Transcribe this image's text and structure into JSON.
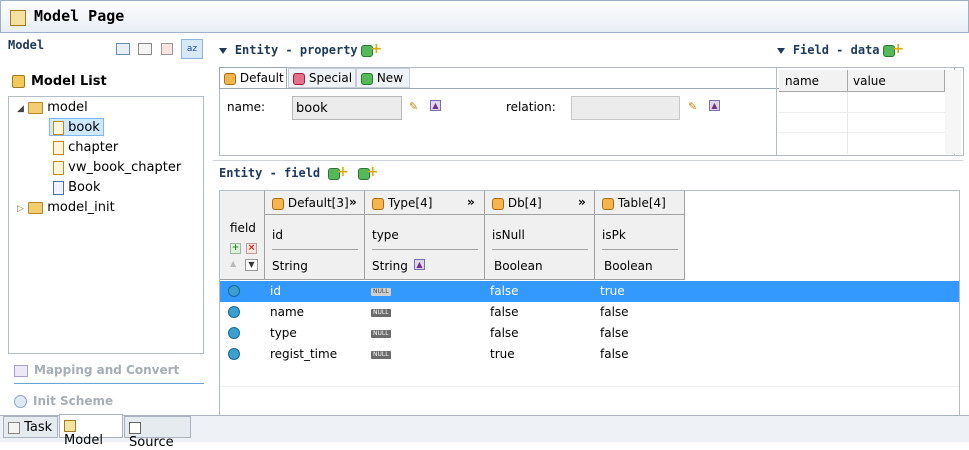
{
  "window": {
    "title": "Model Page"
  },
  "left": {
    "section": "Model",
    "model_list_label": "Model List",
    "tree": [
      {
        "label": "model"
      },
      {
        "label": "book"
      },
      {
        "label": "chapter"
      },
      {
        "label": "vw_book_chapter"
      },
      {
        "label": "Book"
      },
      {
        "label": "model_init"
      }
    ],
    "mapping_label": "Mapping and Convert",
    "init_label": "Init Scheme"
  },
  "entity_property": {
    "title": "Entity - property",
    "tabs": [
      "Default",
      "Special",
      "New"
    ],
    "name_label": "name:",
    "name_value": "book",
    "relation_label": "relation:",
    "relation_value": ""
  },
  "field_data": {
    "title": "Field - data",
    "columns": [
      "name",
      "value"
    ]
  },
  "entity_field": {
    "title": "Entity - field",
    "row_header": "field",
    "groups": [
      {
        "label": "Default[3]",
        "name": "id",
        "type": "String"
      },
      {
        "label": "Type[4]",
        "name": "type",
        "type": "String"
      },
      {
        "label": "Db[4]",
        "name": "isNull",
        "type": "Boolean"
      },
      {
        "label": "Table[4]",
        "name": "isPk",
        "type": "Boolean"
      }
    ],
    "rows": [
      {
        "id": "id",
        "type": "NULL",
        "isNull": "false",
        "isPk": "true"
      },
      {
        "id": "name",
        "type": "NULL",
        "isNull": "false",
        "isPk": "false"
      },
      {
        "id": "type",
        "type": "NULL",
        "isNull": "false",
        "isPk": "false"
      },
      {
        "id": "regist_time",
        "type": "NULL",
        "isNull": "true",
        "isPk": "false"
      }
    ]
  },
  "bottom_tabs": [
    "Task",
    "Model",
    "Source"
  ],
  "colors": {
    "selection": "#3399ff",
    "title": "#1d3a5c"
  }
}
